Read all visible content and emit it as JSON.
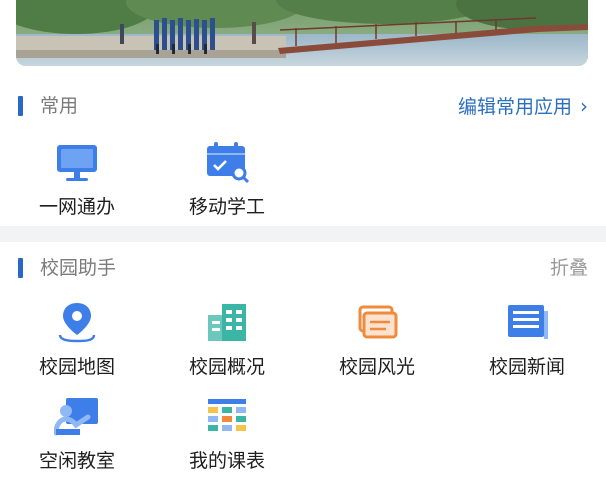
{
  "common": {
    "title": "常用",
    "action": "编辑常用应用",
    "items": [
      {
        "label": "一网通办",
        "icon": "monitor-icon"
      },
      {
        "label": "移动学工",
        "icon": "mobile-student-affairs-icon"
      }
    ]
  },
  "assistant": {
    "title": "校园助手",
    "action": "折叠",
    "items": [
      {
        "label": "校园地图",
        "icon": "map-pin-icon"
      },
      {
        "label": "校园概况",
        "icon": "campus-building-icon"
      },
      {
        "label": "校园风光",
        "icon": "scenery-cards-icon"
      },
      {
        "label": "校园新闻",
        "icon": "news-doc-icon"
      },
      {
        "label": "空闲教室",
        "icon": "classroom-board-icon"
      },
      {
        "label": "我的课表",
        "icon": "timetable-grid-icon"
      }
    ]
  },
  "colors": {
    "accent": "#2a67c7",
    "link": "#2b6fbf",
    "icon_blue": "#3d7ee8",
    "icon_teal": "#3bb5a6",
    "icon_orange": "#f08a3c"
  }
}
